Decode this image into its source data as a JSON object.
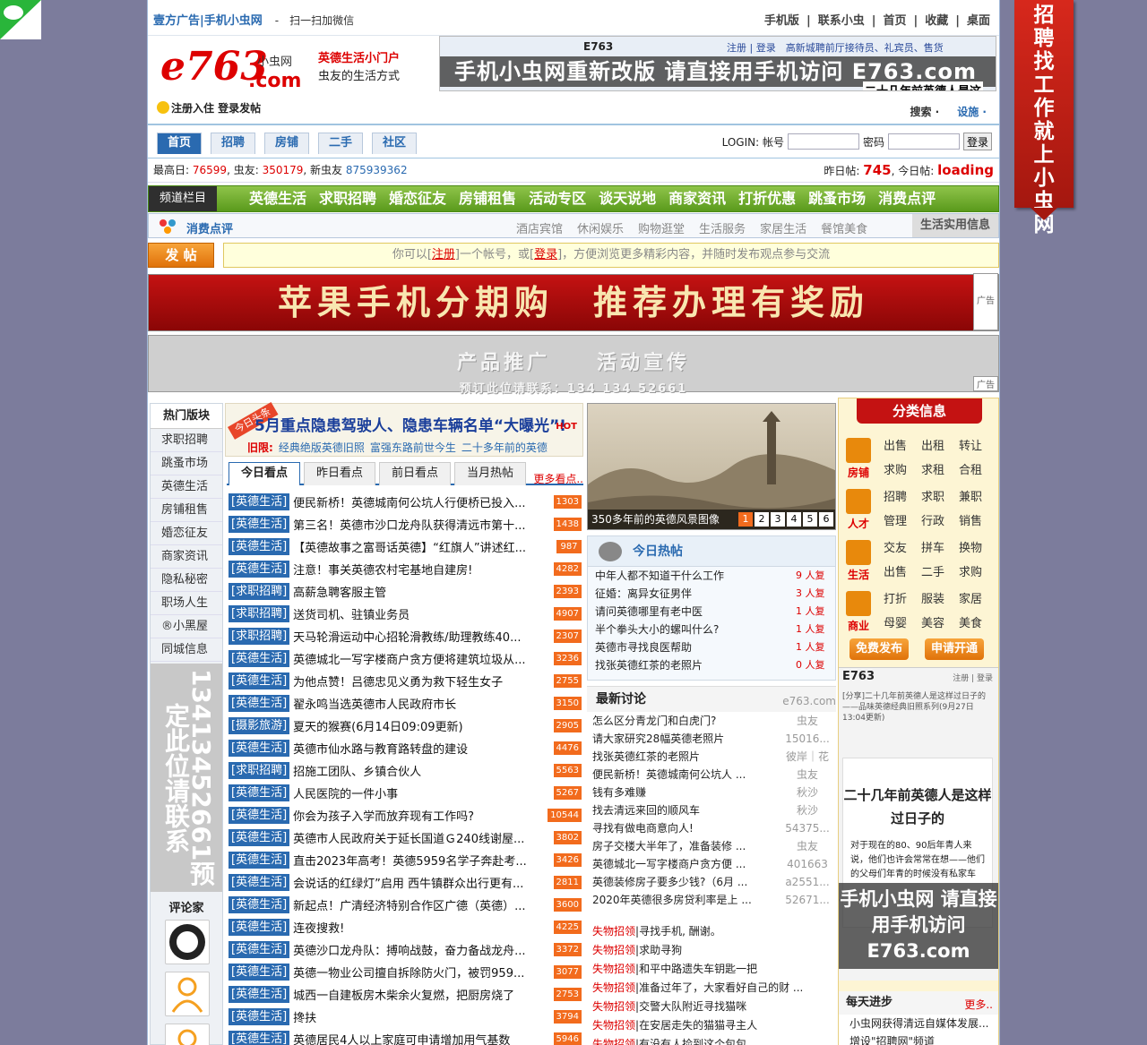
{
  "side_banner": {
    "text": "招聘找工作就上小虫网"
  },
  "top": {
    "left_text": "壹方广告|手机小虫网",
    "wx_text": "-　扫一扫加微信",
    "right_links": [
      "手机版",
      "|",
      "联系小虫",
      "|",
      "首页",
      "|",
      "收藏",
      "|",
      "桌面"
    ]
  },
  "logo": {
    "brand": "e763",
    "com": ".com",
    "xc": "小虫网",
    "slogan_a": "英德生活小门户",
    "slogan_b": "虫友的生活方式"
  },
  "header_ad": {
    "banner": "手机小虫网重新改版 请直接用手机访问 E763.com",
    "tl": "E763",
    "tr": "注册 | 登录　高新城聘前厅接待员、礼宾员、售货",
    "br": "二十几年前英德人是这"
  },
  "register": {
    "text": "注册入住 登录发帖"
  },
  "tools": {
    "search": "搜索 ·",
    "settings": "设施 ·"
  },
  "nav": {
    "tabs": [
      "首页",
      "招聘",
      "房铺",
      "二手",
      "社区"
    ]
  },
  "login": {
    "label": "LOGIN: 帐号",
    "pwd": "密码",
    "btn": "登录"
  },
  "stats": {
    "high_label": "最高日:",
    "high": "76599",
    "users_label": ", 虫友:",
    "users": "350179",
    "new_label": ", 新虫友",
    "new": "875939362",
    "yd_label": "昨日帖:",
    "yd": "745",
    "td_label": ", 今日帖:",
    "td": "loading"
  },
  "channel": {
    "label": "频道栏目",
    "items": [
      "英德生活",
      "求职招聘",
      "婚恋征友",
      "房铺租售",
      "活动专区",
      "谈天说地",
      "商家资讯",
      "打折优惠",
      "跳蚤市场",
      "消费点评"
    ]
  },
  "sub": {
    "title": "消费点评",
    "items": [
      "酒店宾馆",
      "休闲娱乐",
      "购物逛堂",
      "生活服务",
      "家居生活",
      "餐馆美食"
    ],
    "life": "生活实用信息"
  },
  "post": {
    "btn": "发 帖",
    "note_a": "你可以[",
    "note_reg": "注册",
    "note_b": "]一个帐号，或[",
    "note_login": "登录",
    "note_c": "]，方便浏览更多精彩内容，并随时发布观点参与交流"
  },
  "ads": {
    "ad1": "苹果手机分期购　推荐办理有奖励",
    "ad2_a": "产品推广　　活动宣传",
    "ad2_b": "预订此位请联系：134 134 52661",
    "tag": "广告"
  },
  "left": {
    "head": "热门版块",
    "items": [
      "求职招聘",
      "跳蚤市场",
      "英德生活",
      "房铺租售",
      "婚恋征友",
      "商家资讯",
      "隐私秘密",
      "职场人生",
      "®小黑屋",
      "同城信息"
    ],
    "vert": "13413452661预定此位请联系",
    "review": "评论家"
  },
  "headline": {
    "stamp": "今日头条",
    "title": "5月重点隐患驾驶人、隐患车辆名单“大曝光”!",
    "hot": "HOT",
    "old_label": "旧限:",
    "old": [
      "经典绝版英德旧照",
      "富强东路前世今生",
      "二十多年前的英德"
    ]
  },
  "tabs": {
    "items": [
      "今日看点",
      "昨日看点",
      "前日看点",
      "当月热帖"
    ],
    "more": "更多看点.."
  },
  "news": [
    {
      "c": "[英德生活]",
      "t": "便民新桥！英德城南何公坑人行便桥已投入...",
      "n": "1303"
    },
    {
      "c": "[英德生活]",
      "t": "第三名！英德市沙口龙舟队获得清远市第十...",
      "n": "1438"
    },
    {
      "c": "[英德生活]",
      "t": "【英德故事之富哥话英德】“红旗人”讲述红...",
      "n": "987"
    },
    {
      "c": "[英德生活]",
      "t": "注意！事关英德农村宅基地自建房!",
      "n": "4282"
    },
    {
      "c": "[求职招聘]",
      "t": "高薪急聘客服主管",
      "n": "2393"
    },
    {
      "c": "[求职招聘]",
      "t": "送货司机、驻镇业务员",
      "n": "4907"
    },
    {
      "c": "[求职招聘]",
      "t": "天马轮滑运动中心招轮滑教练/助理教练40...",
      "n": "2307"
    },
    {
      "c": "[英德生活]",
      "t": "英德城北一写字楼商户贪方便将建筑垃圾从...",
      "n": "3236"
    },
    {
      "c": "[英德生活]",
      "t": "为他点赞！吕德忠见义勇为救下轻生女子",
      "n": "2755"
    },
    {
      "c": "[英德生活]",
      "t": "翟永鸣当选英德市人民政府市长",
      "n": "3150"
    },
    {
      "c": "[摄影旅游]",
      "t": "夏天的猴赛(6月14日09:09更新)",
      "n": "2905"
    },
    {
      "c": "[英德生活]",
      "t": "英德市仙水路与教育路转盘的建设",
      "n": "4476"
    },
    {
      "c": "[求职招聘]",
      "t": "招施工团队、乡镇合伙人",
      "n": "5563"
    },
    {
      "c": "[英德生活]",
      "t": "人民医院的一件小事",
      "n": "5267"
    },
    {
      "c": "[英德生活]",
      "t": "你会为孩子入学而放弃现有工作吗?",
      "n": "10544"
    },
    {
      "c": "[英德生活]",
      "t": "英德市人民政府关于延长国道Ｇ240线谢屋...",
      "n": "3802"
    },
    {
      "c": "[英德生活]",
      "t": "直击2023年高考！英德5959名学子奔赴考...",
      "n": "3426"
    },
    {
      "c": "[英德生活]",
      "t": "会说话的红绿灯”启用 西牛镇群众出行更有...",
      "n": "2811"
    },
    {
      "c": "[英德生活]",
      "t": "新起点！广清经济特别合作区广德（英德）...",
      "n": "3600"
    },
    {
      "c": "[英德生活]",
      "t": "连夜搜救!",
      "n": "4225"
    },
    {
      "c": "[英德生活]",
      "t": "英德沙口龙舟队：搏响战鼓，奋力备战龙舟...",
      "n": "3372"
    },
    {
      "c": "[英德生活]",
      "t": "英德一物业公司擅自拆除防火门，被罚959...",
      "n": "3077"
    },
    {
      "c": "[英德生活]",
      "t": "城西一自建板房木柴余火复燃，把厨房烧了",
      "n": "2753"
    },
    {
      "c": "[英德生活]",
      "t": "搀扶",
      "n": "3794"
    },
    {
      "c": "[英德生活]",
      "t": "英德居民4人以上家庭可申请增加用气基数",
      "n": "5946"
    }
  ],
  "photo": {
    "caption": "350多年前的英德风景图像",
    "nums": [
      "1",
      "2",
      "3",
      "4",
      "5",
      "6"
    ]
  },
  "hot": {
    "title": "今日热帖",
    "rows": [
      {
        "t": "中年人都不知道干什么工作",
        "r": "9 人复"
      },
      {
        "t": "征婚：离异女征男伴",
        "r": "3 人复"
      },
      {
        "t": "请问英德哪里有老中医",
        "r": "1 人复"
      },
      {
        "t": "半个拳头大小的螺叫什么?",
        "r": "1 人复"
      },
      {
        "t": "英德市寻找良医帮助",
        "r": "1 人复"
      },
      {
        "t": "找张英德红茶的老照片",
        "r": "0 人复"
      }
    ]
  },
  "disc": {
    "title": "最新讨论",
    "site": "e763.com",
    "rows": [
      {
        "t": "怎么区分青龙门和白虎门?",
        "a": "虫友"
      },
      {
        "t": "请大家研究28幅英德老照片",
        "a": "15016..."
      },
      {
        "t": "找张英德红茶的老照片",
        "a": "彼岸｜花"
      },
      {
        "t": "便民新桥！英德城南何公坑人 ...",
        "a": "虫友"
      },
      {
        "t": "钱有多难赚",
        "a": "秋沙"
      },
      {
        "t": "找去清远来回的顺风车",
        "a": "秋沙"
      },
      {
        "t": "寻找有做电商意向人!",
        "a": "54375..."
      },
      {
        "t": "房子交楼大半年了，准备装修 ...",
        "a": "虫友"
      },
      {
        "t": "英德城北一写字楼商户贪方便 ...",
        "a": "401663"
      },
      {
        "t": "英德装修房子要多少钱?（6月 ...",
        "a": "a2551..."
      },
      {
        "t": "2020年英德很多房贷利率是上 ...",
        "a": "52671..."
      }
    ]
  },
  "lost": [
    {
      "c": "失物招领",
      "t": "寻找手机, 酬谢。"
    },
    {
      "c": "失物招领",
      "t": "求助寻狗"
    },
    {
      "c": "失物招领",
      "t": "和平中路遗失车钥匙一把"
    },
    {
      "c": "失物招领",
      "t": "准备过年了，大家看好自己的财 ..."
    },
    {
      "c": "失物招领",
      "t": "交警大队附近寻找猫咪"
    },
    {
      "c": "失物招领",
      "t": "在安居走失的猫猫寻主人"
    },
    {
      "c": "失物招领",
      "t": "有没有人捡到这个包包"
    }
  ],
  "rcol": {
    "title": "分类信息",
    "cats": [
      {
        "n": "房铺",
        "g": [
          "出售",
          "出租",
          "转让",
          "求购",
          "求租",
          "合租"
        ]
      },
      {
        "n": "人才",
        "g": [
          "招聘",
          "求职",
          "兼职",
          "管理",
          "行政",
          "销售"
        ]
      },
      {
        "n": "生活",
        "g": [
          "交友",
          "拼车",
          "换物",
          "出售",
          "二手",
          "求购"
        ]
      },
      {
        "n": "商业",
        "g": [
          "打折",
          "服装",
          "家居",
          "母婴",
          "美容",
          "美食"
        ]
      }
    ],
    "btn1": "免费发布",
    "btn2": "申请开通",
    "ad": {
      "hd": "E763",
      "lnk": "注册 | 登录",
      "sm": "[分享]二十几年前英德人是这样过日子的——品味英德经典旧照系列(9月27日13:04更新)",
      "pg_t": "二十几年前英德人是这样过日子的",
      "pg_b": "对于现在的80、90后年青人来说，他们也许会常常在想——他们的父母们年青的时候没有私家车",
      "over": "手机小虫网 请直接用手机访问 E763.com"
    },
    "daily": {
      "title": "每天进步",
      "more": "更多..",
      "rows": [
        "小虫网获得清远自媒体发展...",
        "增设\"招聘网\"频道"
      ]
    }
  }
}
